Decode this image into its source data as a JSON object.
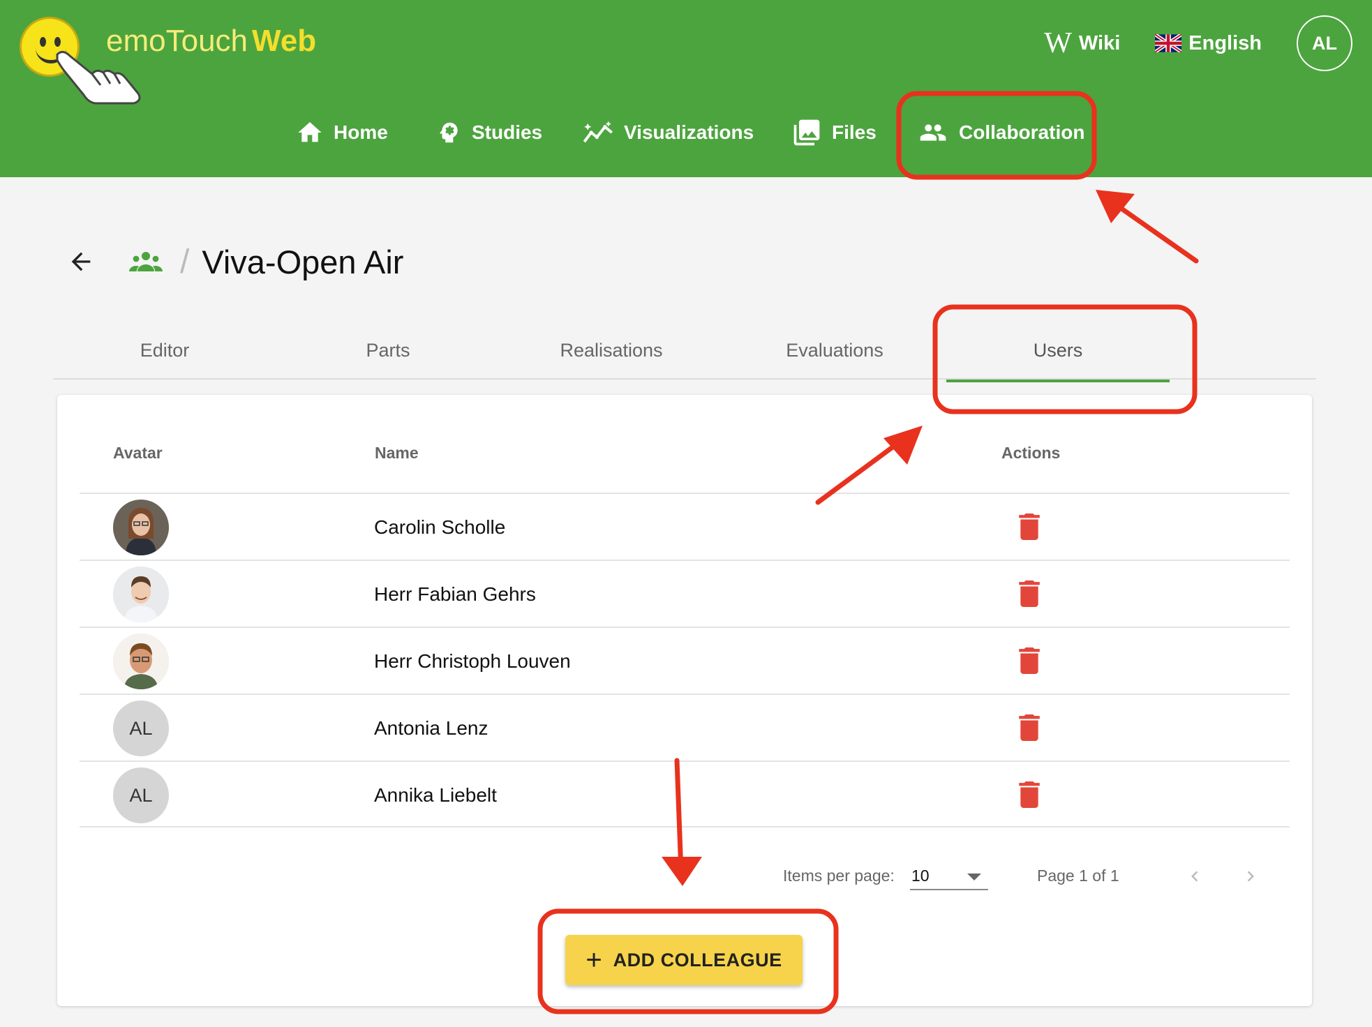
{
  "app": {
    "logo_text_light": "emoTouch",
    "logo_text_bold": "Web"
  },
  "top_right": {
    "wiki_label": "Wiki",
    "language_label": "English",
    "user_initials": "AL"
  },
  "nav": {
    "items": [
      {
        "label": "Home",
        "icon": "home-icon"
      },
      {
        "label": "Studies",
        "icon": "head-gear-icon"
      },
      {
        "label": "Visualizations",
        "icon": "line-chart-icon"
      },
      {
        "label": "Files",
        "icon": "images-icon"
      },
      {
        "label": "Collaboration",
        "icon": "people-icon"
      }
    ]
  },
  "breadcrumb": {
    "separator": "/",
    "title": "Viva-Open Air"
  },
  "tabs": [
    {
      "label": "Editor",
      "active": false
    },
    {
      "label": "Parts",
      "active": false
    },
    {
      "label": "Realisations",
      "active": false
    },
    {
      "label": "Evaluations",
      "active": false
    },
    {
      "label": "Users",
      "active": true
    }
  ],
  "table": {
    "headers": {
      "avatar": "Avatar",
      "name": "Name",
      "actions": "Actions"
    },
    "rows": [
      {
        "avatar": "photo",
        "name": "Carolin Scholle"
      },
      {
        "avatar": "photo",
        "name": "Herr Fabian Gehrs"
      },
      {
        "avatar": "photo",
        "name": "Herr Christoph Louven"
      },
      {
        "avatar": "AL",
        "name": "Antonia Lenz"
      },
      {
        "avatar": "AL",
        "name": "Annika Liebelt"
      }
    ]
  },
  "pagination": {
    "items_per_page_label": "Items per page:",
    "items_per_page_value": "10",
    "page_label": "Page 1 of 1"
  },
  "add_button": {
    "label": "ADD COLLEAGUE",
    "plus": "+"
  },
  "colors": {
    "header_green": "#4ca43e",
    "delete_red": "#e2463a",
    "button_yellow": "#f6d34a",
    "annotation_red": "#e8321e"
  }
}
